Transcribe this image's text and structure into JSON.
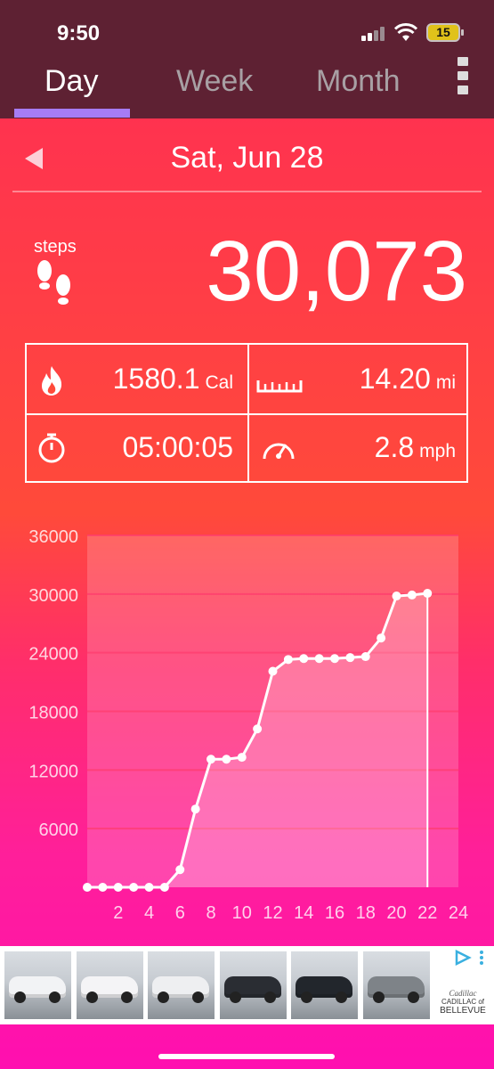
{
  "status_bar": {
    "time": "9:50",
    "battery": "15"
  },
  "tabs": [
    {
      "label": "Day",
      "active": true
    },
    {
      "label": "Week",
      "active": false
    },
    {
      "label": "Month",
      "active": false
    }
  ],
  "date": "Sat, Jun 28",
  "steps": {
    "label": "steps",
    "value": "30,073"
  },
  "stats": {
    "calories": {
      "value": "1580.1",
      "unit": "Cal",
      "icon": "flame-icon"
    },
    "distance": {
      "value": "14.20",
      "unit": "mi",
      "icon": "ruler-icon"
    },
    "duration": {
      "value": "05:00:05",
      "icon": "stopwatch-icon"
    },
    "speed": {
      "value": "2.8",
      "unit": "mph",
      "icon": "speedometer-icon"
    }
  },
  "chart_data": {
    "type": "line",
    "x": [
      0,
      1,
      2,
      3,
      4,
      5,
      6,
      7,
      8,
      9,
      10,
      11,
      12,
      13,
      14,
      15,
      16,
      17,
      18,
      19,
      20,
      21,
      22
    ],
    "y": [
      0,
      0,
      0,
      0,
      0,
      0,
      1800,
      8000,
      13100,
      13100,
      13300,
      16200,
      22100,
      23300,
      23400,
      23400,
      23400,
      23500,
      23600,
      25500,
      29800,
      29900,
      30073
    ],
    "xticks": [
      "2",
      "4",
      "6",
      "8",
      "10",
      "12",
      "14",
      "16",
      "18",
      "20",
      "22",
      "24"
    ],
    "yticks": [
      "6000",
      "12000",
      "18000",
      "24000",
      "30000",
      "36000"
    ],
    "xlim": [
      0,
      24
    ],
    "ylim": [
      0,
      36000
    ],
    "grid": true
  },
  "ad": {
    "brand_line1": "Cadillac",
    "brand_line2": "CADILLAC of",
    "brand_line3": "BELLEVUE",
    "car_colors": [
      "#f2f3f5",
      "#f4f4f6",
      "#eeeff1",
      "#2a2d33",
      "#22262c",
      "#7e8388"
    ]
  }
}
